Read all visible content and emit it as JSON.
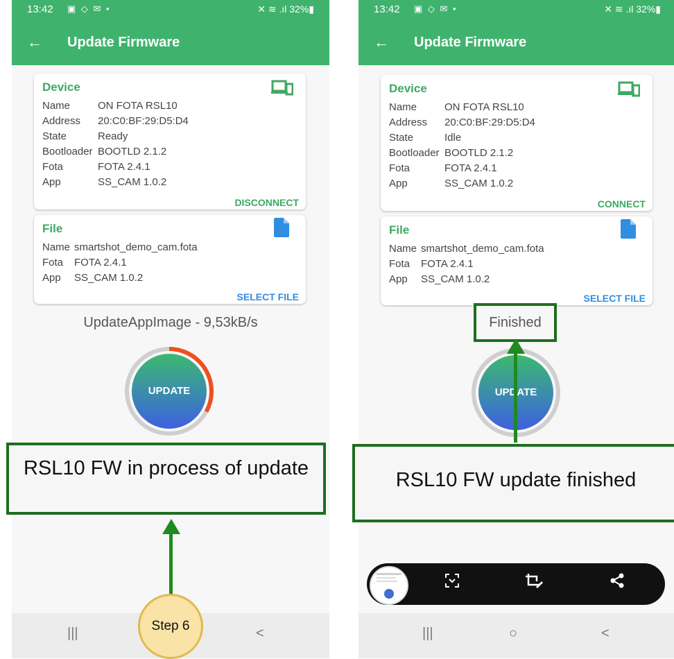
{
  "left_screen": {
    "status": {
      "time": "13:42",
      "left_icons": "▣ ◇ ✉ •",
      "right_icons": "✕ ≋ .ıl 32%▮"
    },
    "appbar": {
      "back": "←",
      "title": "Update Firmware"
    },
    "device_card": {
      "title": "Device",
      "rows": [
        {
          "key": "Name",
          "value": "ON FOTA RSL10"
        },
        {
          "key": "Address",
          "value": "20:C0:BF:29:D5:D4"
        },
        {
          "key": "State",
          "value": "Ready"
        },
        {
          "key": "Bootloader",
          "value": "BOOTLD 2.1.2"
        },
        {
          "key": "Fota",
          "value": "FOTA  2.4.1"
        },
        {
          "key": "App",
          "value": "SS_CAM 1.0.2"
        }
      ],
      "action": "DISCONNECT"
    },
    "file_card": {
      "title": "File",
      "rows": [
        {
          "key": "Name",
          "value": "smartshot_demo_cam.fota"
        },
        {
          "key": "Fota",
          "value": "FOTA  2.4.1"
        },
        {
          "key": "App",
          "value": "SS_CAM 1.0.2"
        }
      ],
      "action": "SELECT FILE"
    },
    "speed_text": "UpdateAppImage - 9,53kB/s",
    "update_button": "UPDATE",
    "progress_fraction": 0.33,
    "callout": "RSL10 FW in process of update",
    "step_label": "Step 6",
    "nav": {
      "recents": "|||",
      "back": "<"
    }
  },
  "right_screen": {
    "status": {
      "time": "13:42",
      "left_icons": "▣ ◇ ✉ •",
      "right_icons": "✕ ≋ .ıl 32%▮"
    },
    "appbar": {
      "back": "←",
      "title": "Update Firmware"
    },
    "device_card": {
      "title": "Device",
      "rows": [
        {
          "key": "Name",
          "value": "ON FOTA RSL10"
        },
        {
          "key": "Address",
          "value": "20:C0:BF:29:D5:D4"
        },
        {
          "key": "State",
          "value": "Idle"
        },
        {
          "key": "Bootloader",
          "value": "BOOTLD 2.1.2"
        },
        {
          "key": "Fota",
          "value": "FOTA  2.4.1"
        },
        {
          "key": "App",
          "value": "SS_CAM 1.0.2"
        }
      ],
      "action": "CONNECT"
    },
    "file_card": {
      "title": "File",
      "rows": [
        {
          "key": "Name",
          "value": "smartshot_demo_cam.fota"
        },
        {
          "key": "Fota",
          "value": "FOTA  2.4.1"
        },
        {
          "key": "App",
          "value": "SS_CAM 1.0.2"
        }
      ],
      "action": "SELECT FILE"
    },
    "finished_text": "Finished",
    "update_button": "UPDATE",
    "callout": "RSL10 FW update finished",
    "toolbar_icons": [
      "scan-icon",
      "crop-edit-icon",
      "share-icon"
    ],
    "nav": {
      "recents": "|||",
      "home": "○",
      "back": "<"
    }
  },
  "colors": {
    "appbar": "#3fb36d",
    "accent_green": "#3fa862",
    "accent_blue": "#2f8ee0",
    "callout_border": "#1e6e1e",
    "progress": "#f0501e"
  }
}
